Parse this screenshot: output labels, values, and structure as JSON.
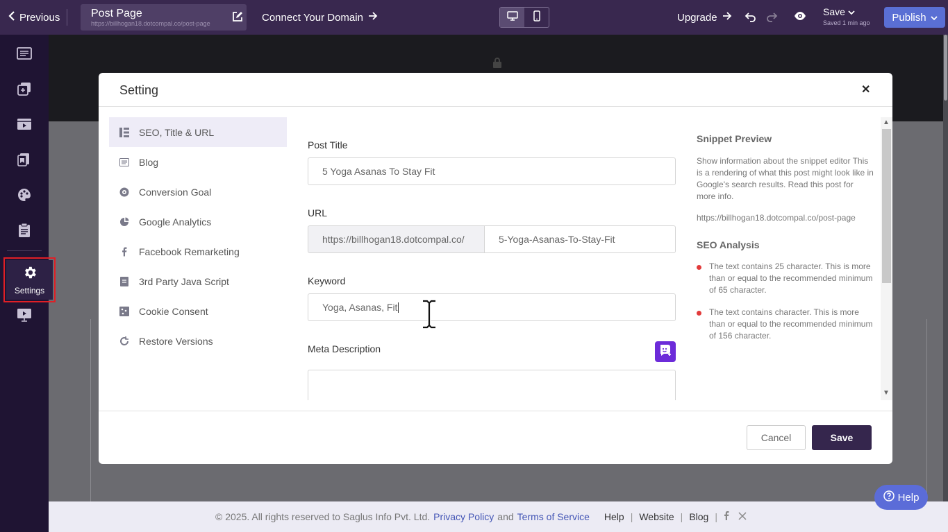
{
  "topbar": {
    "previous_label": "Previous",
    "page_name": "Post Page",
    "page_url": "https://billhogan18.dotcompal.co/post-page",
    "connect_domain_label": "Connect Your Domain",
    "upgrade_label": "Upgrade",
    "save_label": "Save",
    "saved_status": "Saved 1 min ago",
    "publish_label": "Publish"
  },
  "rail": {
    "settings_label": "Settings",
    "icons": [
      "pages-icon",
      "layers-icon",
      "media-icon",
      "bookmarks-icon",
      "palette-icon",
      "clipboard-icon",
      "gear-icon",
      "presentation-icon"
    ]
  },
  "modal": {
    "title": "Setting",
    "menu": [
      {
        "label": "SEO, Title & URL",
        "icon": "seo-icon",
        "active": true
      },
      {
        "label": "Blog",
        "icon": "blog-icon"
      },
      {
        "label": "Conversion Goal",
        "icon": "conversion-goal-icon"
      },
      {
        "label": "Google Analytics",
        "icon": "analytics-icon"
      },
      {
        "label": "Facebook Remarketing",
        "icon": "facebook-icon"
      },
      {
        "label": "3rd Party Java Script",
        "icon": "script-icon"
      },
      {
        "label": "Cookie Consent",
        "icon": "cookie-icon"
      },
      {
        "label": "Restore Versions",
        "icon": "restore-icon"
      }
    ],
    "fields": {
      "post_title_label": "Post Title",
      "post_title_value": "5 Yoga Asanas To Stay Fit",
      "url_label": "URL",
      "url_prefix": "https://billhogan18.dotcompal.co/",
      "url_slug": "5-Yoga-Asanas-To-Stay-Fit",
      "keyword_label": "Keyword",
      "keyword_value": "Yoga, Asanas, Fit",
      "meta_description_label": "Meta Description",
      "meta_description_value": ""
    },
    "snippet": {
      "title": "Snippet Preview",
      "description": "Show information about the snippet editor This is a rendering of what this post might look like in Google's search results. Read this post for more info.",
      "url": "https://billhogan18.dotcompal.co/post-page"
    },
    "seo_analysis": {
      "title": "SEO Analysis",
      "items": [
        "The text contains 25 character. This is more than or equal to the recommended minimum of 65 character.",
        "The text contains character. This is more than or equal to the recommended minimum of 156 character."
      ]
    },
    "cancel_label": "Cancel",
    "save_label": "Save"
  },
  "footer": {
    "copyright": "©  2025. All rights reserved to Saglus Info Pvt. Ltd.",
    "privacy": "Privacy Policy",
    "and": "and",
    "terms": "Terms of Service",
    "help": "Help",
    "website": "Website",
    "blog": "Blog"
  },
  "help_button_label": "Help",
  "colors": {
    "topbar": "#39284f",
    "rail": "#1f1433",
    "publish": "#5a6fd4",
    "primary_dark": "#35264d",
    "highlight_red": "#e01f26"
  }
}
